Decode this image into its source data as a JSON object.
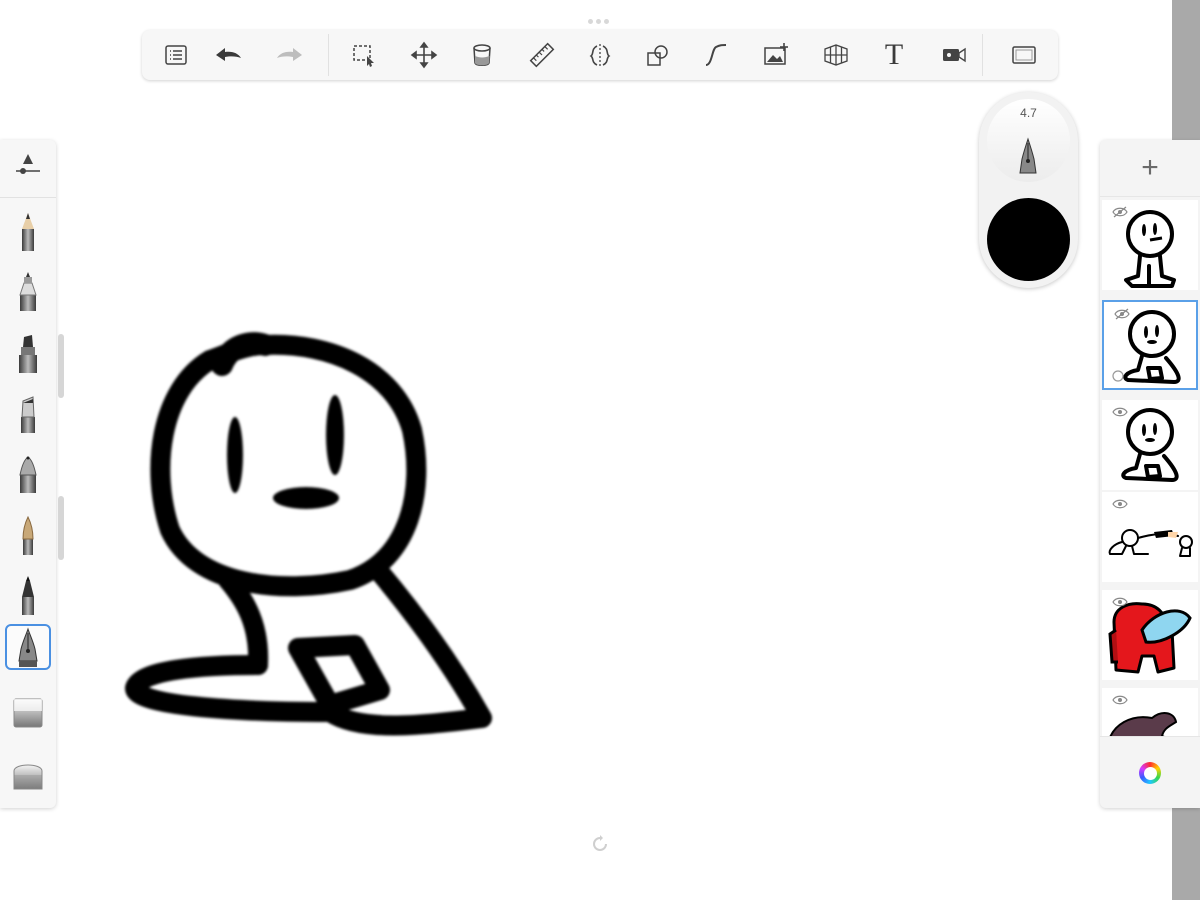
{
  "app": {
    "accent_color": "#4a90e2",
    "background_color": "#ffffff"
  },
  "toolbar": {
    "items": [
      {
        "name": "list-icon"
      },
      {
        "name": "undo-icon"
      },
      {
        "name": "redo-icon"
      },
      {
        "name": "selection-icon"
      },
      {
        "name": "transform-icon"
      },
      {
        "name": "fill-bucket-icon"
      },
      {
        "name": "ruler-icon"
      },
      {
        "name": "symmetry-icon"
      },
      {
        "name": "shapes-icon"
      },
      {
        "name": "curve-icon"
      },
      {
        "name": "add-image-icon"
      },
      {
        "name": "perspective-icon"
      },
      {
        "name": "text-icon",
        "label": "T"
      },
      {
        "name": "record-icon"
      },
      {
        "name": "fullscreen-icon"
      }
    ]
  },
  "brushes": {
    "selected_index": 7,
    "items": [
      "pencil",
      "ballpoint-pen",
      "marker",
      "felt-tip",
      "fineliner",
      "paintbrush",
      "airbrush",
      "ink-pen",
      "smudge",
      "eraser"
    ]
  },
  "puck": {
    "brush_size": "4.7",
    "color": "#000000"
  },
  "layers": {
    "add_label": "+",
    "selected_index": 1,
    "items": [
      {
        "visible": false,
        "name": "figure-standing"
      },
      {
        "visible": false,
        "name": "figure-sitting"
      },
      {
        "visible": true,
        "name": "figure-sitting-copy"
      },
      {
        "visible": true,
        "name": "figures-scene"
      },
      {
        "visible": true,
        "name": "red-crewmate"
      },
      {
        "visible": true,
        "name": "brown-creature"
      }
    ]
  }
}
